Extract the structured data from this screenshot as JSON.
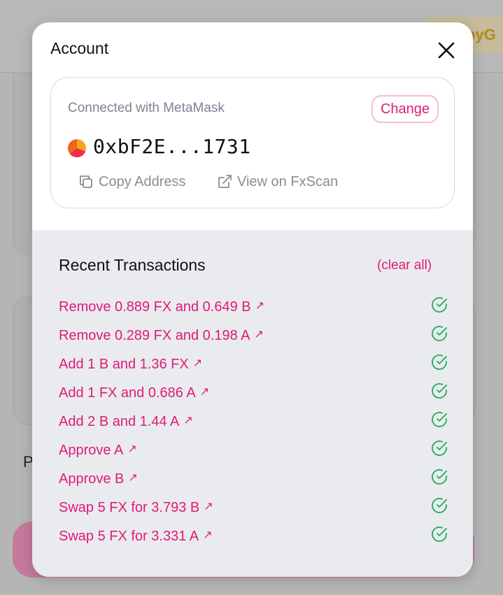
{
  "background": {
    "brand_fragment": "byG",
    "letter_fragment": "P"
  },
  "modal": {
    "title": "Account",
    "close_icon": "close-icon",
    "account": {
      "connected_text": "Connected with MetaMask",
      "change_label": "Change",
      "address": "0xbF2E...1731",
      "copy_label": "Copy Address",
      "view_label": "View on FxScan"
    },
    "transactions": {
      "heading": "Recent Transactions",
      "clear_label": "(clear all)",
      "items": [
        {
          "label": "Remove 0.889 FX and 0.649 B",
          "arrow": "↗",
          "status": "success"
        },
        {
          "label": "Remove 0.289 FX and 0.198 A",
          "arrow": "↗",
          "status": "success"
        },
        {
          "label": "Add 1 B and 1.36 FX",
          "arrow": "↗",
          "status": "success"
        },
        {
          "label": "Add 1 FX and 0.686 A",
          "arrow": "↗",
          "status": "success"
        },
        {
          "label": "Add 2 B and 1.44 A",
          "arrow": "↗",
          "status": "success"
        },
        {
          "label": "Approve A",
          "arrow": "↗",
          "status": "success"
        },
        {
          "label": "Approve B",
          "arrow": "↗",
          "status": "success"
        },
        {
          "label": "Swap 5 FX for 3.793 B",
          "arrow": "↗",
          "status": "success"
        },
        {
          "label": "Swap 5 FX for 3.331 A",
          "arrow": "↗",
          "status": "success"
        }
      ]
    }
  },
  "colors": {
    "accent": "#e01a77",
    "success": "#27ae60",
    "muted_text": "#828292",
    "tx_background": "#eaebef"
  }
}
